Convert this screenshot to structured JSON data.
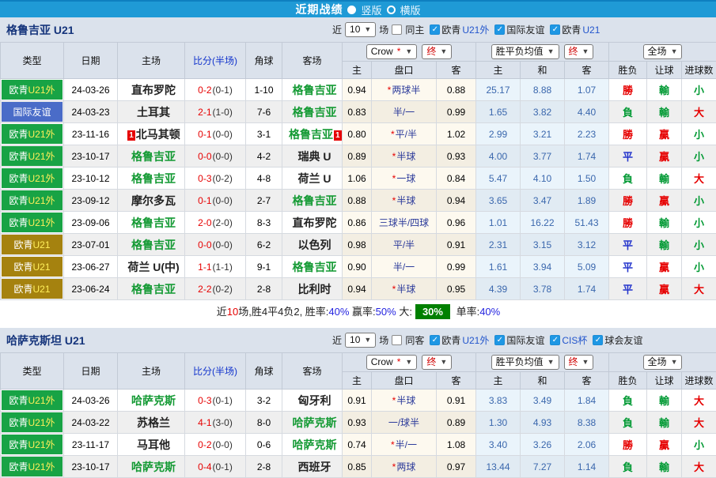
{
  "topbar": {
    "title": "近期战绩",
    "vertical_label": "竖版",
    "horizontal_label": "横版"
  },
  "controls": {
    "near_label": "近",
    "matches_label": "场",
    "bookmaker": "Crow",
    "bookmaker_star": "*",
    "final": "终",
    "avg_select": "胜平负均值",
    "scope_select": "全场"
  },
  "table_columns": {
    "type": "类型",
    "date": "日期",
    "home": "主场",
    "score": "比分(半场)",
    "corner": "角球",
    "away": "客场",
    "odds_home": "主",
    "handicap": "盘口",
    "odds_away": "客",
    "avg_home": "主",
    "avg_draw": "和",
    "avg_away": "客",
    "result_wdl": "胜负",
    "result_handicap": "让球",
    "result_goals": "进球数"
  },
  "sections": [
    {
      "team": "格鲁吉亚 U21",
      "near_count": "10",
      "same_side_label": "同主",
      "leagues": [
        {
          "black": "欧青",
          "blue": "U21外"
        },
        {
          "black": "国际友谊",
          "blue": ""
        },
        {
          "black": "欧青",
          "blue": "U21"
        }
      ],
      "rows": [
        {
          "t1": "欧青",
          "t2": "U21外",
          "color": "green",
          "date": "24-03-26",
          "home": "直布罗陀",
          "hg": false,
          "hcard": "",
          "score": "0-2",
          "half": "(0-1)",
          "corner": "1-10",
          "away": "格鲁吉亚",
          "ag": true,
          "acard": "",
          "oh": "0.94",
          "star": "*",
          "hc": "两球半",
          "oa": "0.88",
          "ah": "25.17",
          "ad": "8.88",
          "aa": "1.07",
          "rw": "勝",
          "rl": "輸",
          "rg": "小"
        },
        {
          "t1": "国际友谊",
          "t2": "",
          "color": "blue",
          "date": "24-03-23",
          "home": "土耳其",
          "hg": false,
          "hcard": "",
          "score": "2-1",
          "half": "(1-0)",
          "corner": "7-6",
          "away": "格鲁吉亚",
          "ag": true,
          "acard": "",
          "oh": "0.83",
          "star": "",
          "hc": "半/一",
          "oa": "0.99",
          "ah": "1.65",
          "ad": "3.82",
          "aa": "4.40",
          "rw": "負",
          "rl": "輸",
          "rg": "大"
        },
        {
          "t1": "欧青",
          "t2": "U21外",
          "color": "green",
          "date": "23-11-16",
          "home": "北马其顿",
          "hg": false,
          "hcard": "1",
          "score": "0-1",
          "half": "(0-0)",
          "corner": "3-1",
          "away": "格鲁吉亚",
          "ag": true,
          "acard": "1",
          "oh": "0.80",
          "star": "*",
          "hc": "平/半",
          "oa": "1.02",
          "ah": "2.99",
          "ad": "3.21",
          "aa": "2.23",
          "rw": "勝",
          "rl": "贏",
          "rg": "小"
        },
        {
          "t1": "欧青",
          "t2": "U21外",
          "color": "green",
          "date": "23-10-17",
          "home": "格鲁吉亚",
          "hg": true,
          "hcard": "",
          "score": "0-0",
          "half": "(0-0)",
          "corner": "4-2",
          "away": "瑞典 U",
          "ag": false,
          "acard": "",
          "oh": "0.89",
          "star": "*",
          "hc": "半球",
          "oa": "0.93",
          "ah": "4.00",
          "ad": "3.77",
          "aa": "1.74",
          "rw": "平",
          "rl": "贏",
          "rg": "小"
        },
        {
          "t1": "欧青",
          "t2": "U21外",
          "color": "green",
          "date": "23-10-12",
          "home": "格鲁吉亚",
          "hg": true,
          "hcard": "",
          "score": "0-3",
          "half": "(0-2)",
          "corner": "4-8",
          "away": "荷兰 U",
          "ag": false,
          "acard": "",
          "oh": "1.06",
          "star": "*",
          "hc": "一球",
          "oa": "0.84",
          "ah": "5.47",
          "ad": "4.10",
          "aa": "1.50",
          "rw": "負",
          "rl": "輸",
          "rg": "大"
        },
        {
          "t1": "欧青",
          "t2": "U21外",
          "color": "green",
          "date": "23-09-12",
          "home": "摩尔多瓦",
          "hg": false,
          "hcard": "",
          "score": "0-1",
          "half": "(0-0)",
          "corner": "2-7",
          "away": "格鲁吉亚",
          "ag": true,
          "acard": "",
          "oh": "0.88",
          "star": "*",
          "hc": "半球",
          "oa": "0.94",
          "ah": "3.65",
          "ad": "3.47",
          "aa": "1.89",
          "rw": "勝",
          "rl": "贏",
          "rg": "小"
        },
        {
          "t1": "欧青",
          "t2": "U21外",
          "color": "green",
          "date": "23-09-06",
          "home": "格鲁吉亚",
          "hg": true,
          "hcard": "",
          "score": "2-0",
          "half": "(2-0)",
          "corner": "8-3",
          "away": "直布罗陀",
          "ag": false,
          "acard": "",
          "oh": "0.86",
          "star": "",
          "hc": "三球半/四球",
          "oa": "0.96",
          "ah": "1.01",
          "ad": "16.22",
          "aa": "51.43",
          "rw": "勝",
          "rl": "輸",
          "rg": "小"
        },
        {
          "t1": "欧青",
          "t2": "U21",
          "color": "brown",
          "date": "23-07-01",
          "home": "格鲁吉亚",
          "hg": true,
          "hcard": "",
          "score": "0-0",
          "half": "(0-0)",
          "corner": "6-2",
          "away": "以色列",
          "ag": false,
          "acard": "",
          "oh": "0.98",
          "star": "",
          "hc": "平/半",
          "oa": "0.91",
          "ah": "2.31",
          "ad": "3.15",
          "aa": "3.12",
          "rw": "平",
          "rl": "輸",
          "rg": "小"
        },
        {
          "t1": "欧青",
          "t2": "U21",
          "color": "brown",
          "date": "23-06-27",
          "home": "荷兰 U(中)",
          "hg": false,
          "hcard": "",
          "score": "1-1",
          "half": "(1-1)",
          "corner": "9-1",
          "away": "格鲁吉亚",
          "ag": true,
          "acard": "",
          "oh": "0.90",
          "star": "",
          "hc": "半/一",
          "oa": "0.99",
          "ah": "1.61",
          "ad": "3.94",
          "aa": "5.09",
          "rw": "平",
          "rl": "贏",
          "rg": "小"
        },
        {
          "t1": "欧青",
          "t2": "U21",
          "color": "brown",
          "date": "23-06-24",
          "home": "格鲁吉亚",
          "hg": true,
          "hcard": "",
          "score": "2-2",
          "half": "(0-2)",
          "corner": "2-8",
          "away": "比利时",
          "ag": false,
          "acard": "",
          "oh": "0.94",
          "star": "*",
          "hc": "半球",
          "oa": "0.95",
          "ah": "4.39",
          "ad": "3.78",
          "aa": "1.74",
          "rw": "平",
          "rl": "贏",
          "rg": "大"
        }
      ],
      "summary": [
        {
          "text": "近",
          "c": "k"
        },
        {
          "text": "10",
          "c": "r"
        },
        {
          "text": "场,胜4平4负2, 胜率:",
          "c": "k"
        },
        {
          "text": "40%",
          "c": "b"
        },
        {
          "text": " 赢率:",
          "c": "k"
        },
        {
          "text": "50%",
          "c": "b"
        },
        {
          "text": " 大:",
          "c": "k"
        },
        {
          "text": "30%",
          "c": "g"
        },
        {
          "text": " 单率:",
          "c": "k"
        },
        {
          "text": "40%",
          "c": "b"
        }
      ]
    },
    {
      "team": "哈萨克斯坦 U21",
      "near_count": "10",
      "same_side_label": "同客",
      "leagues": [
        {
          "black": "欧青",
          "blue": "U21外"
        },
        {
          "black": "国际友谊",
          "blue": ""
        },
        {
          "black": "",
          "blue": "CIS杯"
        },
        {
          "black": "球会友谊",
          "blue": ""
        }
      ],
      "rows": [
        {
          "t1": "欧青",
          "t2": "U21外",
          "color": "green",
          "date": "24-03-26",
          "home": "哈萨克斯",
          "hg": true,
          "hcard": "",
          "score": "0-3",
          "half": "(0-1)",
          "corner": "3-2",
          "away": "匈牙利",
          "ag": false,
          "acard": "",
          "oh": "0.91",
          "star": "*",
          "hc": "半球",
          "oa": "0.91",
          "ah": "3.83",
          "ad": "3.49",
          "aa": "1.84",
          "rw": "負",
          "rl": "輸",
          "rg": "大"
        },
        {
          "t1": "欧青",
          "t2": "U21外",
          "color": "green",
          "date": "24-03-22",
          "home": "苏格兰",
          "hg": false,
          "hcard": "",
          "score": "4-1",
          "half": "(3-0)",
          "corner": "8-0",
          "away": "哈萨克斯",
          "ag": true,
          "acard": "",
          "oh": "0.93",
          "star": "",
          "hc": "一/球半",
          "oa": "0.89",
          "ah": "1.30",
          "ad": "4.93",
          "aa": "8.38",
          "rw": "負",
          "rl": "輸",
          "rg": "大"
        },
        {
          "t1": "欧青",
          "t2": "U21外",
          "color": "green",
          "date": "23-11-17",
          "home": "马耳他",
          "hg": false,
          "hcard": "",
          "score": "0-2",
          "half": "(0-0)",
          "corner": "0-6",
          "away": "哈萨克斯",
          "ag": true,
          "acard": "",
          "oh": "0.74",
          "star": "*",
          "hc": "半/一",
          "oa": "1.08",
          "ah": "3.40",
          "ad": "3.26",
          "aa": "2.06",
          "rw": "勝",
          "rl": "贏",
          "rg": "小"
        },
        {
          "t1": "欧青",
          "t2": "U21外",
          "color": "green",
          "date": "23-10-17",
          "home": "哈萨克斯",
          "hg": true,
          "hcard": "",
          "score": "0-4",
          "half": "(0-1)",
          "corner": "2-8",
          "away": "西班牙",
          "ag": false,
          "acard": "",
          "oh": "0.85",
          "star": "*",
          "hc": "两球",
          "oa": "0.97",
          "ah": "13.44",
          "ad": "7.27",
          "aa": "1.14",
          "rw": "負",
          "rl": "輸",
          "rg": "大"
        }
      ]
    }
  ]
}
